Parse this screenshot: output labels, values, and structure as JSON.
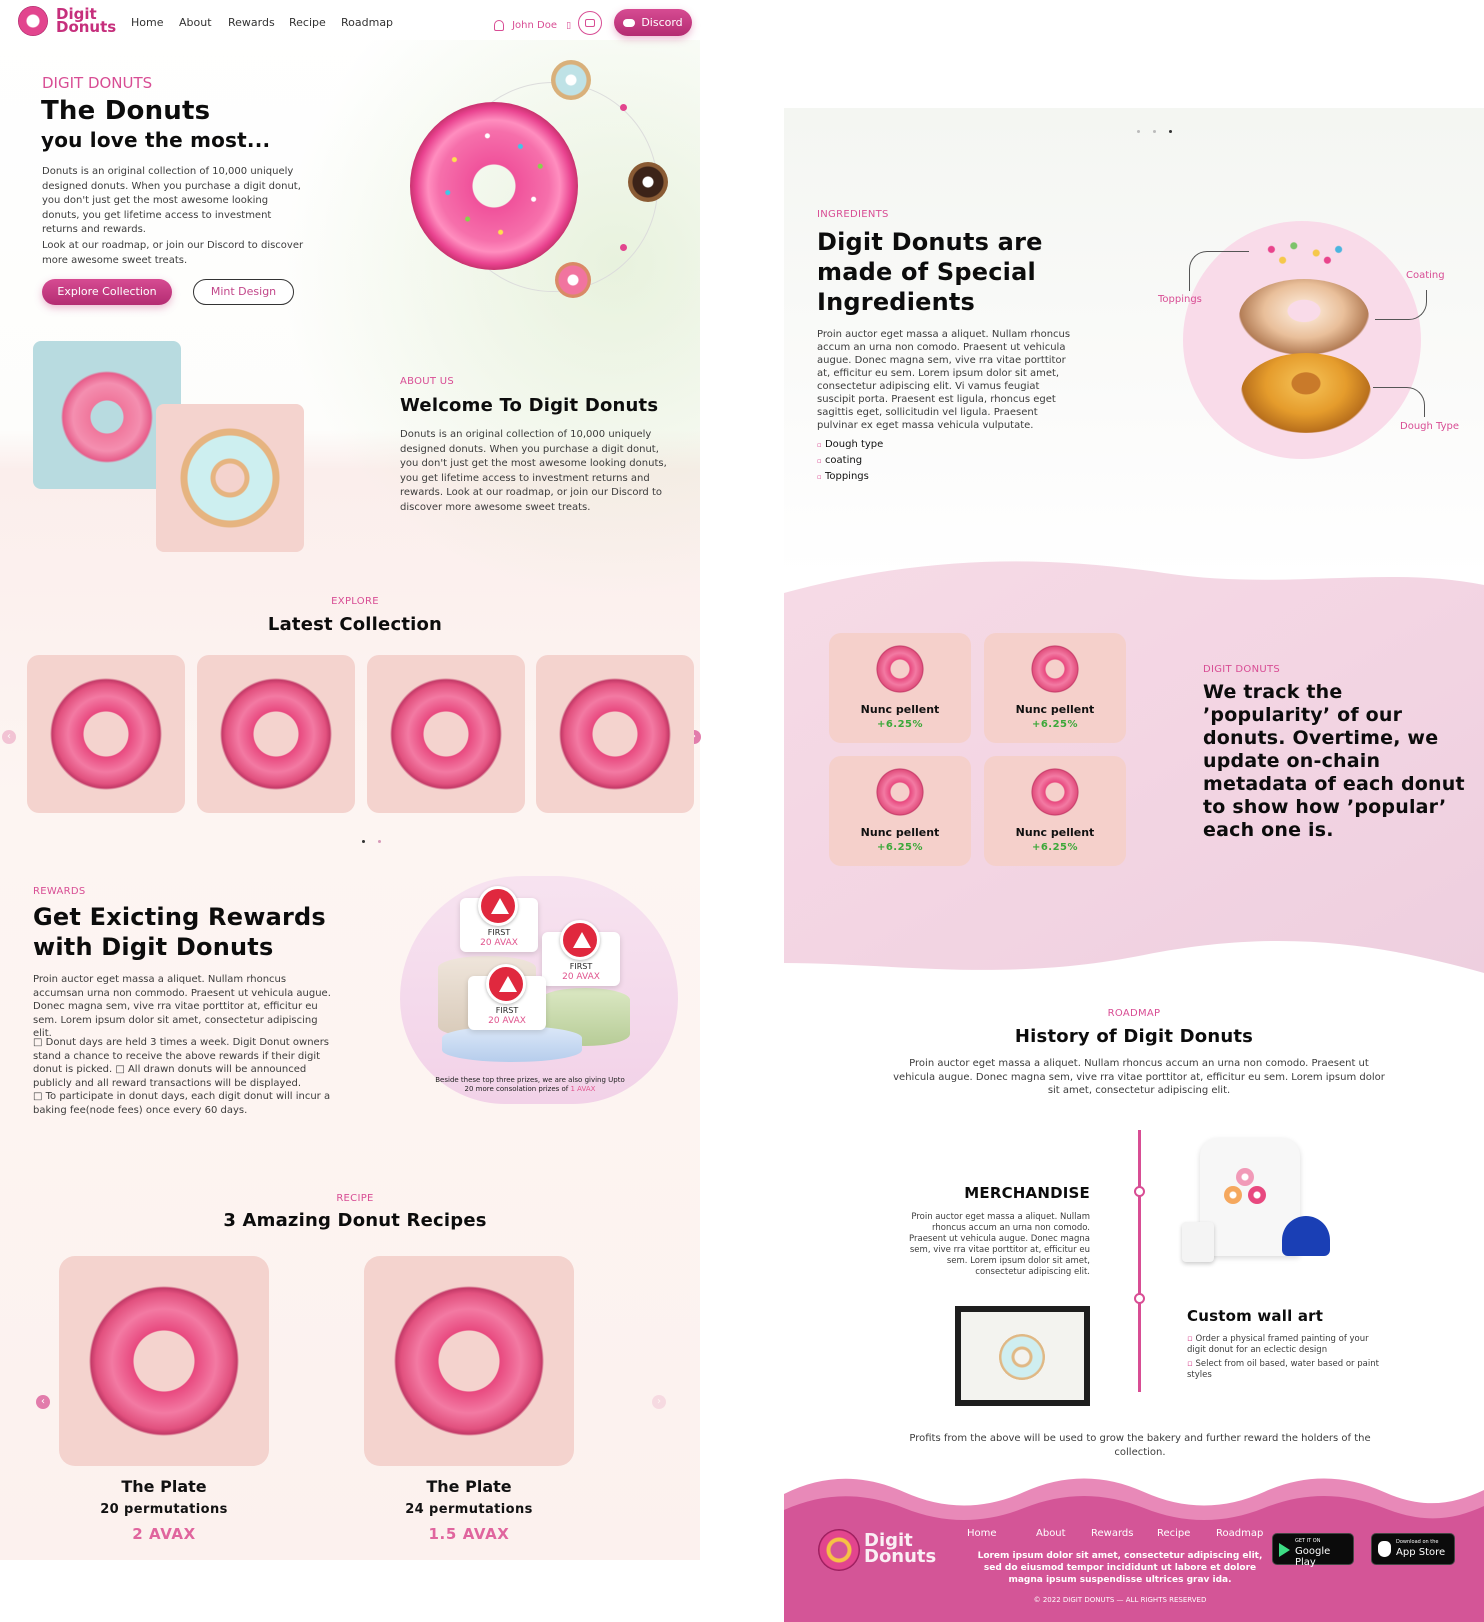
{
  "nav": {
    "logo_line1": "Digit",
    "logo_line2": "Donuts",
    "links": [
      "Home",
      "About",
      "Rewards",
      "Recipe",
      "Roadmap"
    ],
    "user_name": "John Doe",
    "discord_label": "Discord"
  },
  "hero": {
    "eyebrow": "DIGIT DONUTS",
    "title_line1": "The Donuts",
    "title_line2": "you love the most...",
    "description": "Donuts is an original collection of 10,000 uniquely designed donuts. When you purchase a digit donut, you don't just get the most awesome looking donuts, you get lifetime access to investment returns and rewards.",
    "description2": "Look at our roadmap, or join our Discord to discover more awesome sweet treats.",
    "primary_button": "Explore Collection",
    "secondary_button": "Mint Design"
  },
  "about": {
    "eyebrow": "ABOUT US",
    "title": "Welcome To Digit Donuts",
    "description": "Donuts is an original collection of 10,000 uniquely designed donuts. When you purchase a digit donut, you don't just get the most awesome looking donuts, you get lifetime access to investment returns and rewards. Look at our roadmap, or join our Discord to discover more awesome sweet treats."
  },
  "collection": {
    "eyebrow": "EXPLORE",
    "title": "Latest Collection"
  },
  "rewards": {
    "eyebrow": "REWARDS",
    "title_line1": "Get Exicting Rewards",
    "title_line2": "with Digit Donuts",
    "description": "Proin auctor eget massa a aliquet. Nullam rhoncus accumsan urna non commodo. Praesent ut vehicula augue. Donec magna sem, vive rra vitae porttitor at, efficitur eu sem. Lorem ipsum dolor sit amet, consectetur adipiscing elit.",
    "bullets": "□ Donut days are held 3 times a week. Digit Donut owners stand a chance to receive the above rewards if their digit donut is picked. □ All drawn donuts will be announced publicly and all reward transactions will be displayed.\n□ To participate in donut days, each digit donut will incur a baking fee(node fees) once every 60 days.",
    "prize_label": "FIRST",
    "prize_amount": "20 AVAX",
    "prize_note": "Beside these top three prizes, we are also giving Upto 20 more consolation prizes of",
    "prize_note_highlight": "1 AVAX"
  },
  "recipes": {
    "eyebrow": "RECIPE",
    "title": "3 Amazing Donut Recipes",
    "items": [
      {
        "name": "The Plate",
        "permutations": "20 permutations",
        "price": "2 AVAX"
      },
      {
        "name": "The Plate",
        "permutations": "24 permutations",
        "price": "1.5 AVAX"
      }
    ]
  },
  "ingredients": {
    "eyebrow": "INGREDIENTS",
    "title_line1": "Digit Donuts are",
    "title_line2": "made of Special",
    "title_line3": "Ingredients",
    "description": "Proin auctor eget massa a aliquet. Nullam rhoncus accum an urna non comodo. Praesent ut vehicula augue. Donec magna sem, vive rra vitae porttitor at, efficitur eu sem. Lorem ipsum dolor sit amet, consectetur adipiscing elit. Vi vamus feugiat suscipit porta. Praesent est ligula, rhoncus eget sagittis eget, sollicitudin vel ligula. Praesent pulvinar ex eget massa vehicula vulputate.",
    "list": [
      "Dough type",
      "coating",
      "Toppings"
    ],
    "labels": {
      "toppings": "Toppings",
      "coating": "Coating",
      "dough": "Dough Type"
    }
  },
  "popularity": {
    "eyebrow": "DIGIT DONUTS",
    "text": "We track the ’popularity’ of our donuts. Overtime, we update on-chain metadata of each donut to show how ’popular’ each one is.",
    "cards": [
      {
        "name": "Nunc pellent",
        "change": "+6.25%"
      },
      {
        "name": "Nunc pellent",
        "change": "+6.25%"
      },
      {
        "name": "Nunc pellent",
        "change": "+6.25%"
      },
      {
        "name": "Nunc pellent",
        "change": "+6.25%"
      }
    ]
  },
  "roadmap": {
    "eyebrow": "ROADMAP",
    "title": "History of Digit Donuts",
    "description": "Proin auctor eget massa a aliquet. Nullam rhoncus accum an urna non comodo. Praesent ut vehicula augue. Donec magna sem, vive rra vitae porttitor at, efficitur eu sem. Lorem ipsum dolor sit amet, consectetur adipiscing elit.",
    "merch_title": "MERCHANDISE",
    "merch_text": "Proin auctor eget massa a aliquet. Nullam rhoncus accum an urna non comodo. Praesent ut vehicula augue. Donec magna sem, vive rra vitae porttitor at, efficitur eu sem. Lorem ipsum dolor sit amet, consectetur adipiscing elit.",
    "wall_title": "Custom wall art",
    "wall_items": [
      "Order a physical framed painting of your digit donut for an eclectic design",
      "Select from oil based, water based or paint styles"
    ],
    "profits": "Profits from the above will be used to grow the bakery and further reward the holders of the collection."
  },
  "footer": {
    "logo_line1": "Digit",
    "logo_line2": "Donuts",
    "links": [
      "Home",
      "About",
      "Rewards",
      "Recipe",
      "Roadmap"
    ],
    "tagline": "Lorem ipsum dolor sit amet, consectetur adipiscing elit, sed do eiusmod tempor incididunt ut labore et dolore magna ipsum suspendisse ultrices grav ida.",
    "google_small": "GET IT ON",
    "google_big": "Google Play",
    "apple_small": "Download on the",
    "apple_big": "App Store",
    "copyright": "© 2022 DIGIT DONUTS — ALL RIGHTS RESERVED"
  },
  "colors": {
    "accent": "#d84d94",
    "card": "#f4d3ce",
    "green": "#3ca83a",
    "footer": "#d45597"
  }
}
